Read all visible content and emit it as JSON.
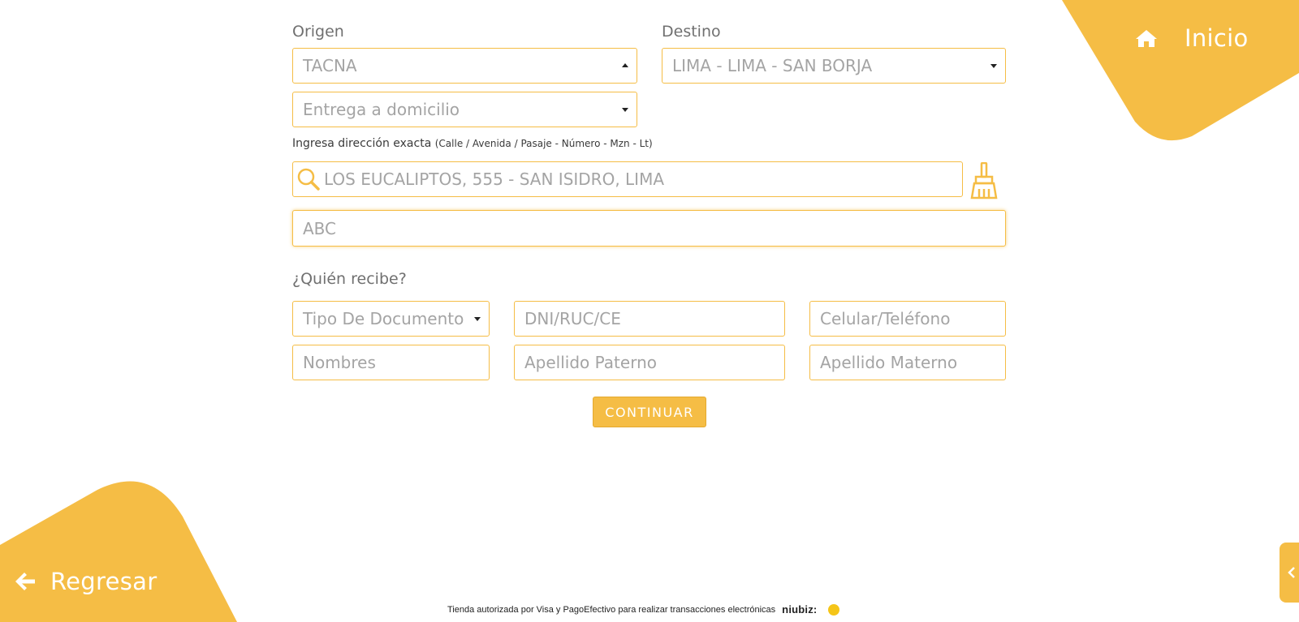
{
  "nav": {
    "home_label": "Inicio",
    "back_label": "Regresar"
  },
  "colors": {
    "accent": "#f5bd45",
    "text": "#707070",
    "placeholder": "#a4a4a4"
  },
  "form": {
    "origin": {
      "label": "Origen",
      "value": "TACNA"
    },
    "destination": {
      "label": "Destino",
      "value": "LIMA - LIMA - SAN BORJA"
    },
    "delivery_mode": {
      "value": "Entrega a domicilio"
    },
    "address_hint": {
      "main": "Ingresa dirección exacta",
      "detail": "(Calle / Avenida / Pasaje - Número - Mzn - Lt)"
    },
    "address_search": {
      "placeholder": "LOS EUCALIPTOS, 555 - SAN ISIDRO, LIMA"
    },
    "reference": {
      "placeholder": "ABC"
    },
    "recipient_title": "¿Quién recibe?",
    "doc_type": {
      "value": "Tipo De Documento"
    },
    "doc_number": {
      "placeholder": "DNI/RUC/CE"
    },
    "phone": {
      "placeholder": "Celular/Teléfono"
    },
    "names": {
      "placeholder": "Nombres"
    },
    "last_name_father": {
      "placeholder": "Apellido Paterno"
    },
    "last_name_mother": {
      "placeholder": "Apellido Materno"
    },
    "continue_label": "CONTINUAR"
  },
  "footer": {
    "text": "Tienda autorizada por Visa y PagoEfectivo para realizar transacciones electrónicas",
    "brand": "niubiz:"
  },
  "icons": {
    "home": "home-icon",
    "back": "arrow-left-icon",
    "search": "search-icon",
    "clear": "broom-icon",
    "side_tab": "chevron-left-icon"
  }
}
